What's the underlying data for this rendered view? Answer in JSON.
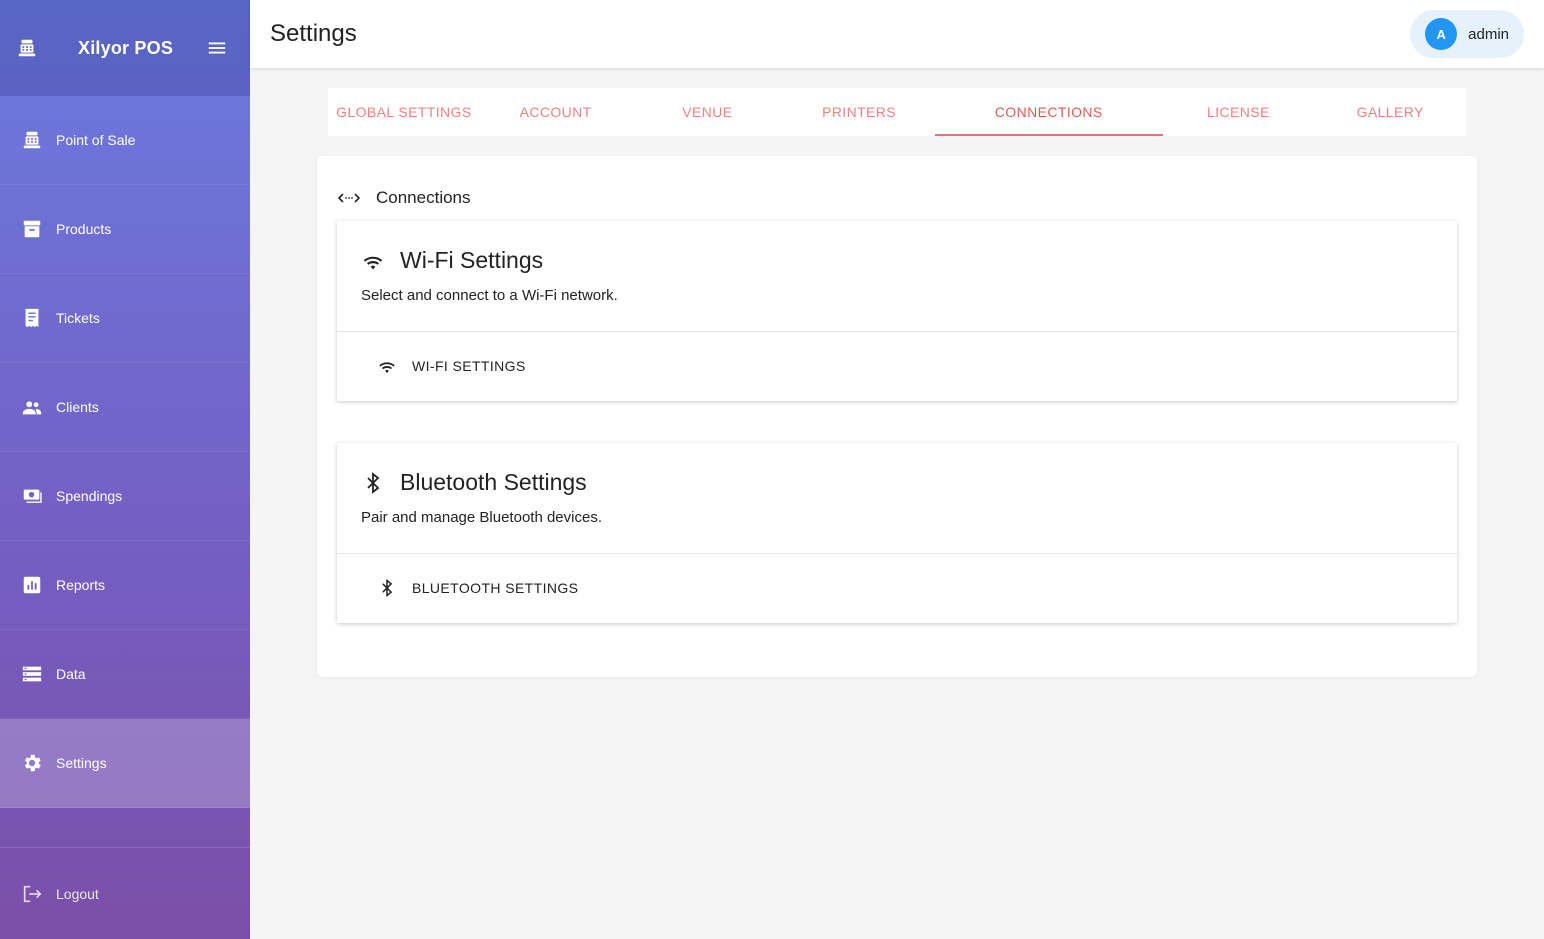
{
  "app": {
    "name": "Xilyor POS"
  },
  "sidebar": {
    "items": [
      {
        "label": "Point of Sale",
        "icon": "cash-register-icon"
      },
      {
        "label": "Products",
        "icon": "archive-icon"
      },
      {
        "label": "Tickets",
        "icon": "receipt-icon"
      },
      {
        "label": "Clients",
        "icon": "people-icon"
      },
      {
        "label": "Spendings",
        "icon": "money-icon"
      },
      {
        "label": "Reports",
        "icon": "chart-icon"
      },
      {
        "label": "Data",
        "icon": "storage-icon"
      },
      {
        "label": "Settings",
        "icon": "gear-icon",
        "active": true
      }
    ],
    "logout": "Logout"
  },
  "header": {
    "title": "Settings"
  },
  "user": {
    "initial": "A",
    "name": "admin"
  },
  "tabs": [
    {
      "label": "GLOBAL SETTINGS"
    },
    {
      "label": "ACCOUNT"
    },
    {
      "label": "VENUE"
    },
    {
      "label": "PRINTERS"
    },
    {
      "label": "CONNECTIONS",
      "active": true
    },
    {
      "label": "LICENSE"
    },
    {
      "label": "GALLERY"
    }
  ],
  "panel": {
    "title": "Connections",
    "cards": [
      {
        "title": "Wi-Fi Settings",
        "description": "Select and connect to a Wi-Fi network.",
        "action": "WI-FI SETTINGS",
        "icon": "wifi-icon"
      },
      {
        "title": "Bluetooth Settings",
        "description": "Pair and manage Bluetooth devices.",
        "action": "BLUETOOTH SETTINGS",
        "icon": "bluetooth-icon"
      }
    ]
  },
  "colors": {
    "accent": "#e35a55",
    "tab_text": "#f0827e",
    "avatar": "#2196f3",
    "chip_bg": "#e5f1fb"
  }
}
